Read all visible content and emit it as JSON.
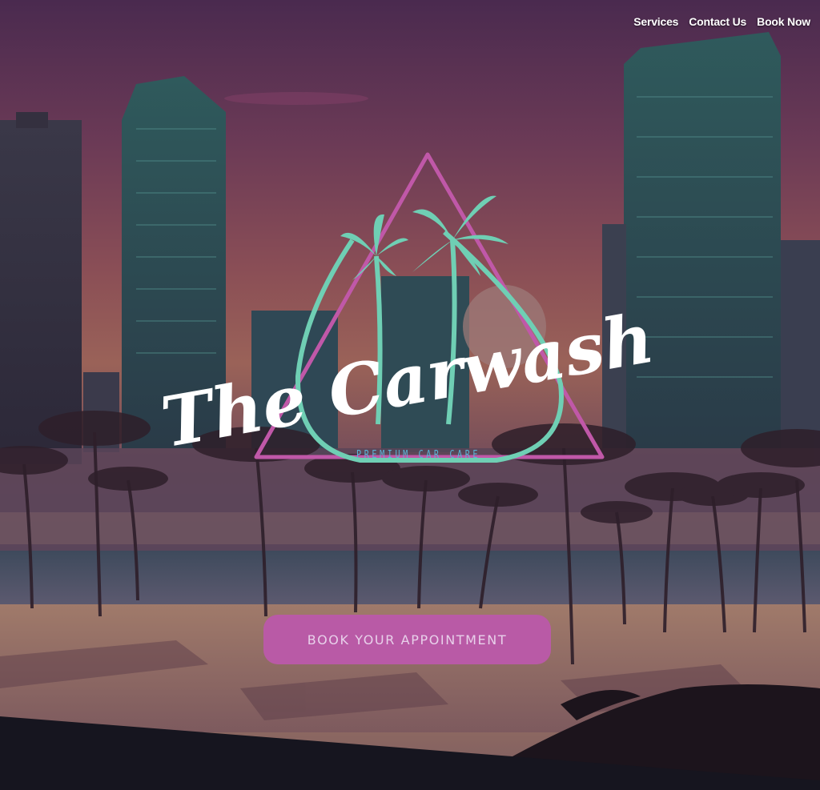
{
  "nav": {
    "items": [
      {
        "label": "Services"
      },
      {
        "label": "Contact Us"
      },
      {
        "label": "Book Now"
      }
    ]
  },
  "logo": {
    "title": "The Carwash",
    "tagline": "PREMIUM CAR CARE"
  },
  "cta": {
    "label": "BOOK YOUR APPOINTMENT"
  },
  "colors": {
    "accent_pink": "#b95aa6",
    "accent_teal": "#6fcfb4",
    "tagline_blue": "#5ab4d8",
    "triangle": "#c058a8"
  }
}
